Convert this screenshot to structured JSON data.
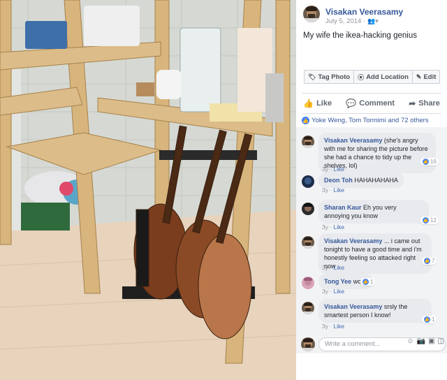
{
  "post": {
    "author": "Visakan Veerasamy",
    "date": "July 5, 2014 ·",
    "audience_icon": "friends-icon",
    "text": "My wife the ikea-hacking genius"
  },
  "photo_toolbar": {
    "tag_photo": "Tag Photo",
    "add_location": "Add Location",
    "edit": "Edit"
  },
  "actions": {
    "like": "Like",
    "comment": "Comment",
    "share": "Share"
  },
  "reactions": {
    "summary": "Yoke Weng, Tom Tormimi and 72 others"
  },
  "comments": [
    {
      "name": "Visakan Veerasamy",
      "text": "(she's angry with me for sharing the picture before she had a chance to tidy up the shelves, lol)",
      "time": "3y",
      "like": "Like",
      "likes": "16"
    },
    {
      "name": "Deon Toh",
      "text": "HAHAHAHAHA",
      "time": "3y",
      "like": "Like",
      "likes": ""
    },
    {
      "name": "Sharan Kaur",
      "text": "Eh you very annoying you know",
      "time": "3y",
      "like": "Like",
      "likes": "12"
    },
    {
      "name": "Visakan Veerasamy",
      "text": "... i came out tonight to have a good time and i'm honestly feeling so attacked right now",
      "time": "3y",
      "like": "Like",
      "likes": "7"
    },
    {
      "name": "Tong Yee",
      "text": "wow.",
      "time": "3y",
      "like": "Like",
      "likes": "1"
    },
    {
      "name": "Visakan Veerasamy",
      "text": "srsly the smartest person I know!",
      "time": "3y",
      "like": "Like",
      "likes": "1"
    }
  ],
  "compose": {
    "placeholder": "Write a comment..."
  },
  "colors": {
    "link_blue": "#365899",
    "like_blue": "#4080ff",
    "bubble_gray": "#e8eaee"
  }
}
